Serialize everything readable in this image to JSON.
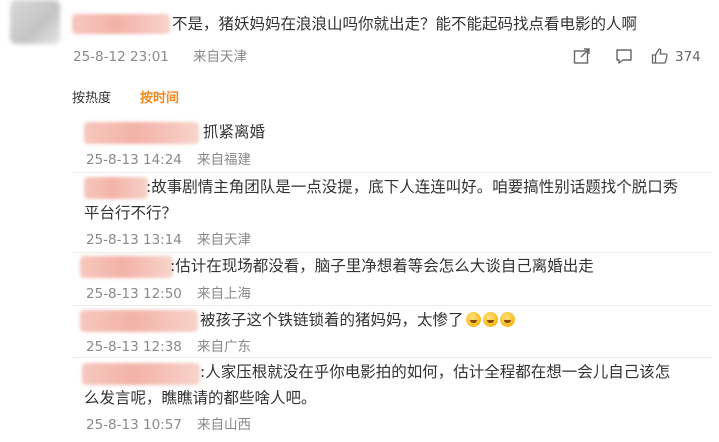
{
  "comment": {
    "text": "不是，猪妖妈妈在浪浪山吗你就出走？能不能起码找点看电影的人啊",
    "time": "25-8-12 23:01",
    "location": "来自天津",
    "like_count": "374",
    "icons": [
      "share-icon",
      "comment-icon",
      "like-icon"
    ]
  },
  "sort": {
    "hot_label": "按热度",
    "time_label": "按时间",
    "accent_color": "#f08a1f"
  },
  "replies": [
    {
      "text": "抓紧离婚",
      "time": "25-8-13 14:24",
      "location": "来自福建"
    },
    {
      "line1": ":故事剧情主角团队是一点没提，底下人连连叫好。咱要搞性别话题找个脱口秀",
      "line2": "平台行不行？",
      "time": "25-8-13 13:14",
      "location": "来自天津"
    },
    {
      "text": ":估计在现场都没看，脑子里净想着等会怎么大谈自己离婚出走",
      "time": "25-8-13 12:50",
      "location": "来自上海"
    },
    {
      "text": "被孩子这个铁链锁着的猪妈妈，太惨了",
      "emoji": "crying-face-icon",
      "time": "25-8-13 12:38",
      "location": "来自广东"
    },
    {
      "line1": ":人家压根就没在乎你电影拍的如何，估计全程都在想一会儿自己该怎",
      "line2": "么发言呢，瞧瞧请的都些啥人吧。",
      "time": "25-8-13 10:57",
      "location": "来自山西"
    }
  ]
}
